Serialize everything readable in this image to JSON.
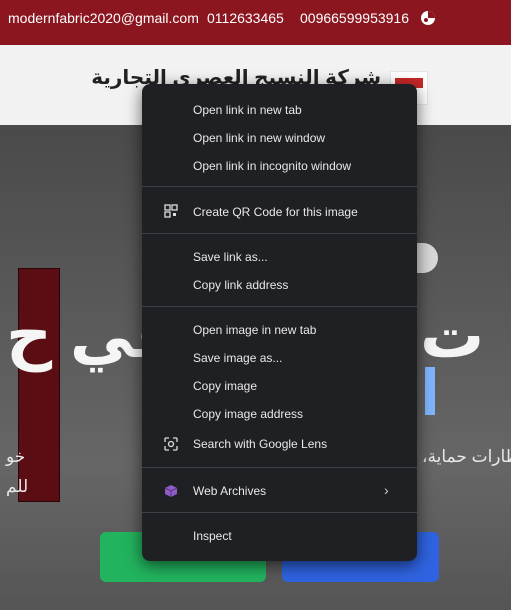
{
  "topbar": {
    "email": "modernfabric2020@gmail.com",
    "phone1": "0112633465",
    "phone2": "00966599953916"
  },
  "header": {
    "company_name": "شركة النسيج العصري التجارية"
  },
  "hero": {
    "pill_label": "",
    "headline_right": "ت",
    "headline_left": "في ح",
    "paragraph_line1": "خو",
    "paragraph_line1_right": "ت، نظارات حماية،",
    "paragraph_line2": "للم",
    "green_button_label": "",
    "blue_button_label": ""
  },
  "context_menu": {
    "open_new_tab": "Open link in new tab",
    "open_new_window": "Open link in new window",
    "open_incognito": "Open link in incognito window",
    "create_qr": "Create QR Code for this image",
    "save_link": "Save link as...",
    "copy_link": "Copy link address",
    "open_image_tab": "Open image in new tab",
    "save_image": "Save image as...",
    "copy_image": "Copy image",
    "copy_image_address": "Copy image address",
    "search_lens": "Search with Google Lens",
    "web_archives": "Web Archives",
    "inspect": "Inspect"
  },
  "colors": {
    "topbar": "#8b1620",
    "menu_bg": "#1f2024",
    "green": "#22b35e",
    "blue": "#2f63e0"
  }
}
